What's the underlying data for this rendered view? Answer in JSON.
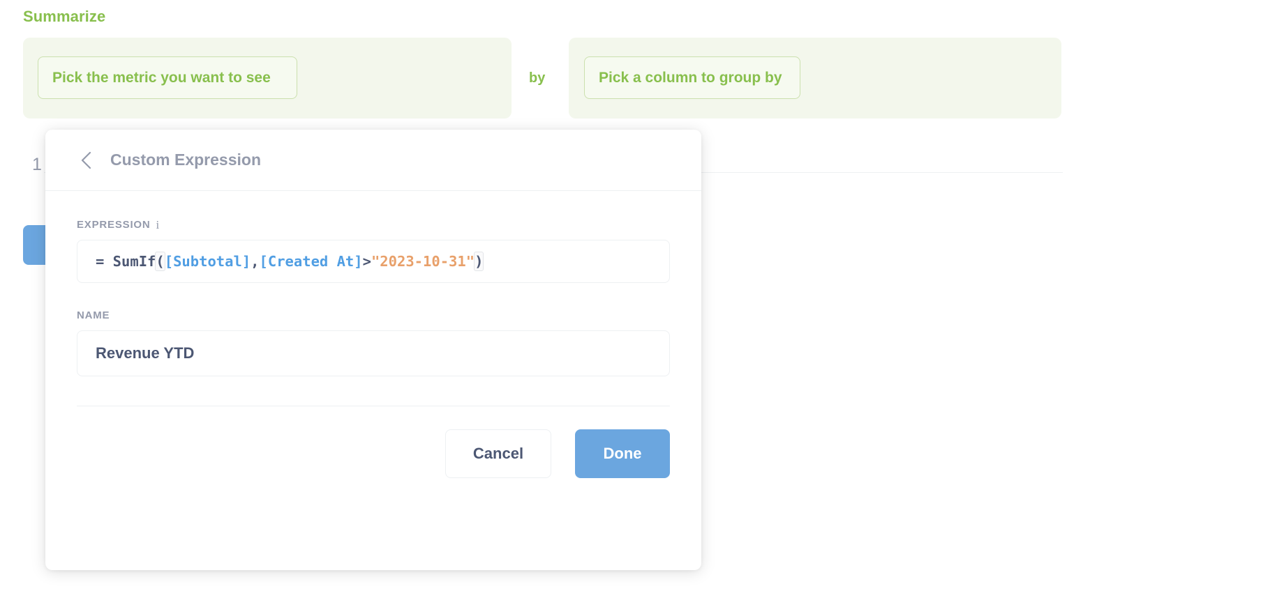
{
  "background": {
    "heading": "Summarize",
    "metric_pill_label": "Pick the metric you want to see",
    "by_label": "by",
    "groupby_pill_label": "Pick a column to group by",
    "step_number": "1",
    "accent_green": "#88BF4D",
    "panel_green": "#F3F7EC"
  },
  "modal": {
    "title": "Custom Expression",
    "back_icon": "chevron-left-icon",
    "expression": {
      "label": "EXPRESSION",
      "info_icon": "info-icon",
      "tokens": [
        {
          "text": "= SumIf",
          "type": "plain"
        },
        {
          "text": "(",
          "type": "paren"
        },
        {
          "text": "[Subtotal]",
          "type": "field"
        },
        {
          "text": ", ",
          "type": "plain"
        },
        {
          "text": "[Created At]",
          "type": "field"
        },
        {
          "text": " > ",
          "type": "plain"
        },
        {
          "text": "\"2023-10-31\"",
          "type": "string"
        },
        {
          "text": ")",
          "type": "paren"
        }
      ],
      "full_text": "= SumIf([Subtotal], [Created At] > \"2023-10-31\")",
      "colors": {
        "plain": "#4C5773",
        "field": "#509EE3",
        "string": "#E8A06A"
      }
    },
    "name": {
      "label": "NAME",
      "value": "Revenue YTD"
    },
    "footer": {
      "cancel_label": "Cancel",
      "done_label": "Done",
      "done_color": "#6BA6DF"
    }
  }
}
